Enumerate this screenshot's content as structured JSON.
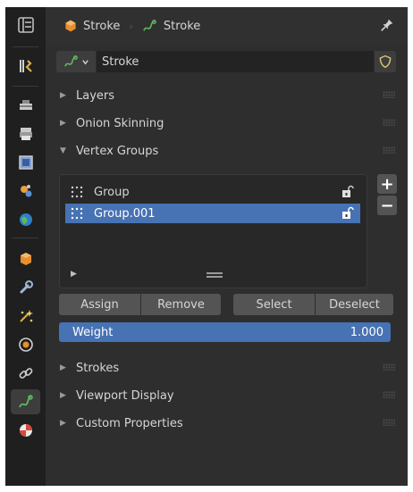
{
  "tabs": [
    {
      "name": "tool",
      "icon": "tool-icon"
    },
    {
      "name": "render",
      "icon": "render-icon"
    },
    {
      "name": "output",
      "icon": "output-icon"
    },
    {
      "name": "view-layer",
      "icon": "view-layer-icon"
    },
    {
      "name": "scene",
      "icon": "scene-icon"
    },
    {
      "name": "world",
      "icon": "world-icon"
    },
    {
      "name": "object",
      "icon": "object-icon"
    },
    {
      "name": "modifiers",
      "icon": "wrench-icon"
    },
    {
      "name": "effects",
      "icon": "sparkle-icon"
    },
    {
      "name": "physics",
      "icon": "physics-icon"
    },
    {
      "name": "constraints",
      "icon": "constraint-icon"
    },
    {
      "name": "data",
      "icon": "stroke-data-icon",
      "active": true
    },
    {
      "name": "material",
      "icon": "material-icon"
    }
  ],
  "header": {
    "object_name": "Stroke",
    "data_name": "Stroke"
  },
  "datablock": {
    "name": "Stroke"
  },
  "sections": {
    "layers": "Layers",
    "onion": "Onion Skinning",
    "vertex_groups": "Vertex Groups",
    "strokes": "Strokes",
    "viewport_display": "Viewport Display",
    "custom_properties": "Custom Properties"
  },
  "vertex_groups": {
    "items": [
      {
        "label": "Group",
        "selected": false
      },
      {
        "label": "Group.001",
        "selected": true
      }
    ],
    "add_label": "+",
    "remove_label": "−"
  },
  "buttons": {
    "assign": "Assign",
    "remove": "Remove",
    "select": "Select",
    "deselect": "Deselect"
  },
  "weight": {
    "label": "Weight",
    "value": "1.000"
  },
  "colors": {
    "accent": "#4772b3",
    "stroke_green": "#5fb85f",
    "object_orange": "#e88f2c"
  }
}
